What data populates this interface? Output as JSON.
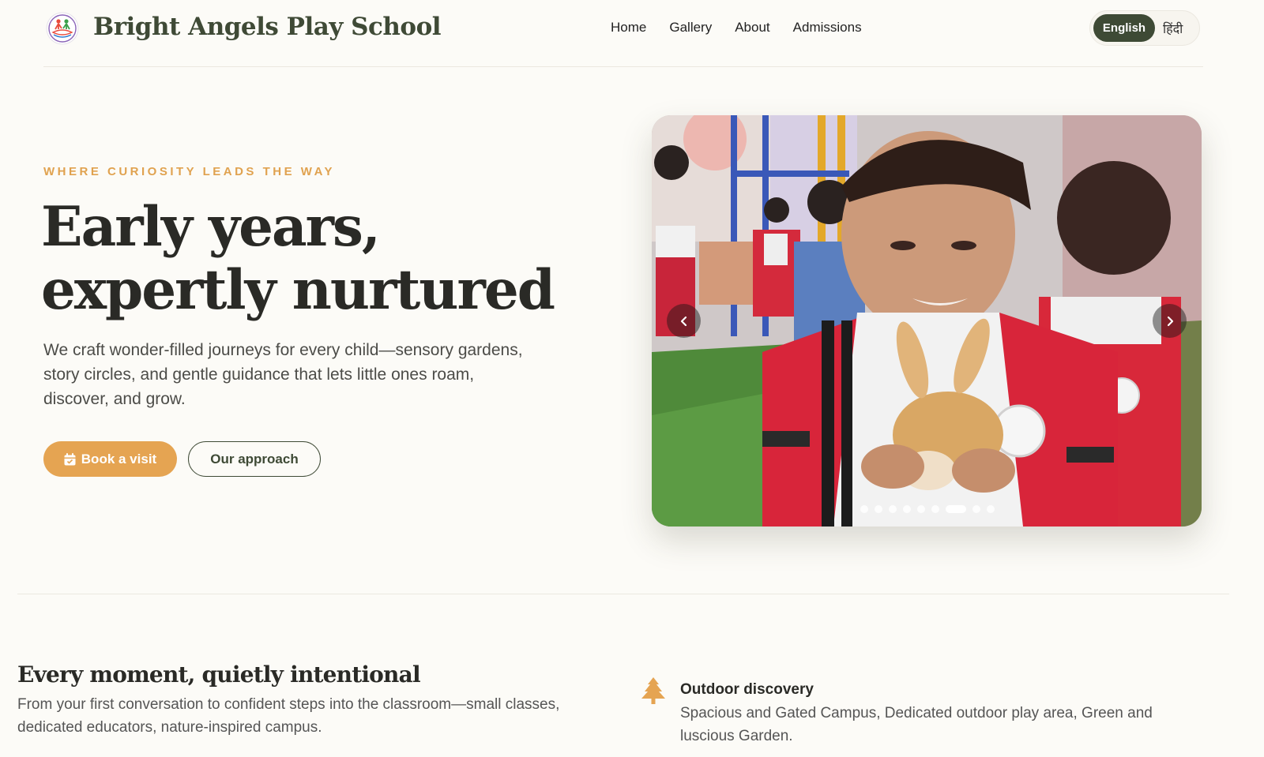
{
  "header": {
    "brand": "Bright Angels Play School",
    "logo_icon": "bright-angels-logo",
    "nav": [
      "Home",
      "Gallery",
      "About",
      "Admissions"
    ],
    "lang": {
      "selected": "English",
      "other": "हिंदी"
    }
  },
  "hero": {
    "eyebrow": "WHERE CURIOSITY LEADS THE WAY",
    "headline_line1": "Early years,",
    "headline_line2": "expertly nurtured",
    "lead": "We craft wonder-filled journeys for every child—sensory gardens, story circles, and gentle guidance that lets little ones roam, discover, and grow.",
    "primary_button": "Book a visit",
    "primary_button_icon": "calendar-icon",
    "secondary_button": "Our approach"
  },
  "carousel": {
    "photo_description_icon": "carousel-photo",
    "slide_count": 10,
    "active_slide": 7,
    "prev_icon": "chevron-left-icon",
    "next_icon": "chevron-right-icon"
  },
  "section": {
    "title": "Every moment, quietly intentional",
    "text": "From your first conversation to confident steps into the classroom—small classes, dedicated educators, nature-inspired campus."
  },
  "feature": {
    "icon": "tree-icon",
    "title": "Outdoor discovery",
    "text": "Spacious and Gated Campus, Dedicated outdoor play area, Green and luscious Garden."
  },
  "colors": {
    "accent": "#e5a452",
    "brand_green": "#3e4a35",
    "background": "#fcfbf7"
  }
}
